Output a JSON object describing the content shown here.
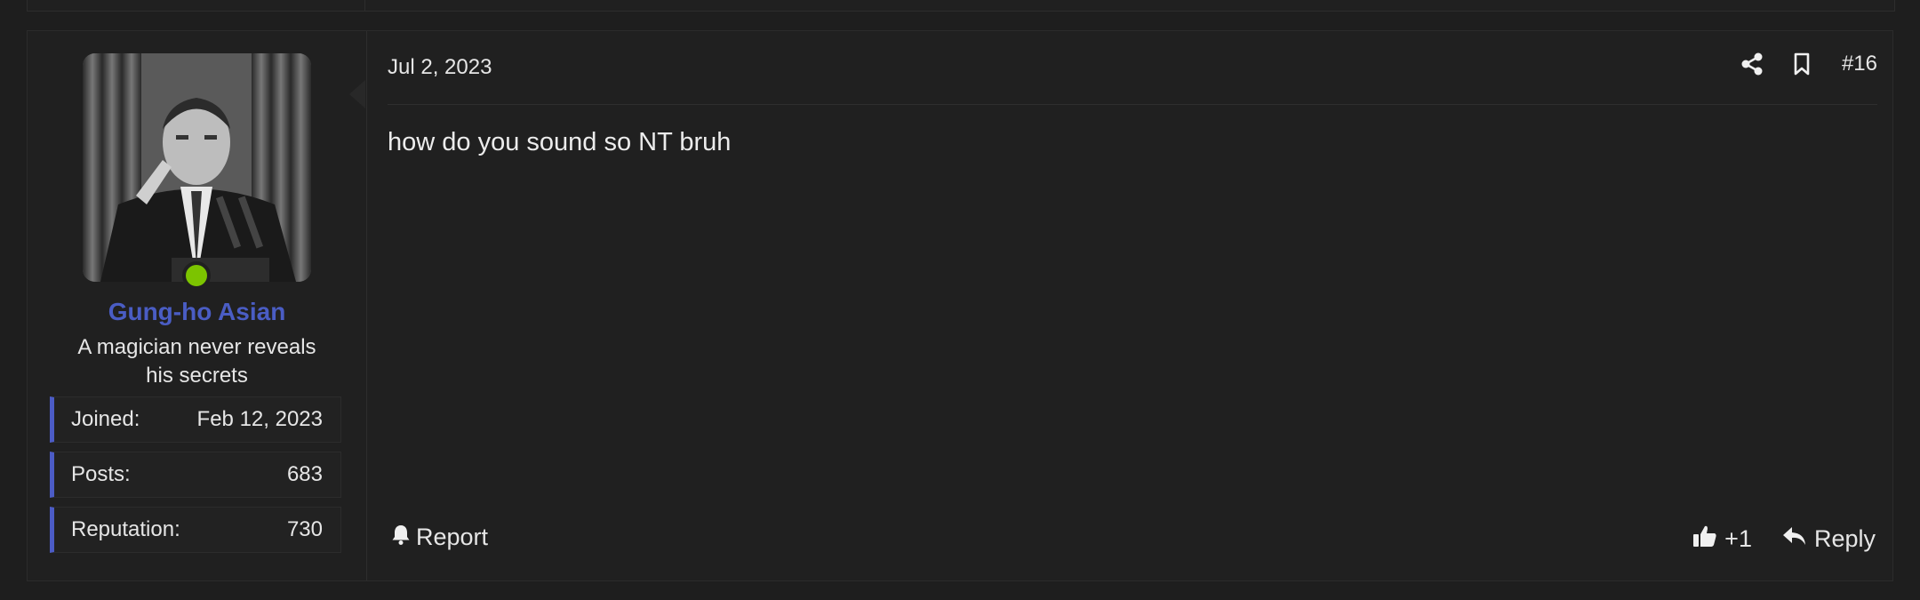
{
  "post": {
    "date": "Jul 2, 2023",
    "number": "#16",
    "message": "how do you sound so NT bruh",
    "author": {
      "name": "Gung-ho Asian",
      "title": "A magician never reveals his secrets",
      "online": true,
      "stats": [
        {
          "label": "Joined:",
          "value": "Feb 12, 2023"
        },
        {
          "label": "Posts:",
          "value": "683"
        },
        {
          "label": "Reputation:",
          "value": "730"
        }
      ]
    },
    "actions": {
      "report": "Report",
      "like_count": "+1",
      "reply": "Reply"
    }
  },
  "icons": [
    "share-icon",
    "bookmark-icon",
    "bell-icon",
    "thumbs-up-icon",
    "reply-arrow-icon"
  ],
  "colors": {
    "username": "#4a5dc4",
    "online": "#7cc400",
    "stat_accent": "#4c5cc6"
  }
}
